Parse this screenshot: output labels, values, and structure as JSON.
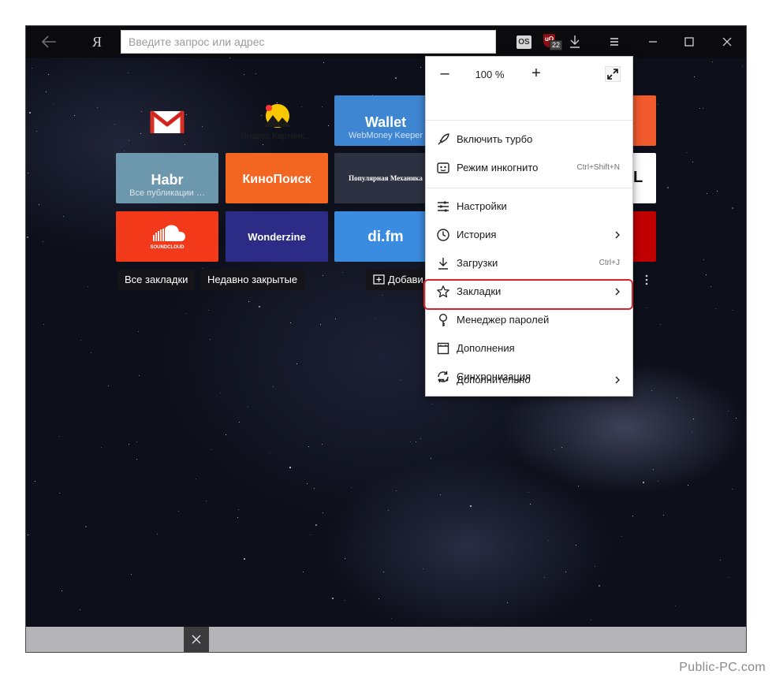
{
  "toolbar": {
    "logo": "Я",
    "address_placeholder": "Введите запрос или адрес",
    "ext_os_label": "OS",
    "ext_ublock_label": "uO",
    "ext_ublock_count": "22"
  },
  "tiles": [
    {
      "title": "",
      "subtitle": "",
      "icon": "gmail-icon",
      "bg": "#ffffff"
    },
    {
      "title": "",
      "subtitle": "Яндекс.Картинк…",
      "icon": "yandex-images-icon",
      "bg": "#ffffff"
    },
    {
      "title": "Wallet",
      "subtitle": "WebMoney Keeper",
      "bg": "#3f86d2"
    },
    {
      "title": "Habr",
      "subtitle": "Все публикации …",
      "bg": "#6d97ad"
    },
    {
      "title": "КиноПоиск",
      "subtitle": "",
      "bg": "#f26622"
    },
    {
      "title": "Популярная Механика",
      "subtitle": "",
      "bg": "#2e3142"
    },
    {
      "title": "",
      "subtitle": "",
      "icon": "soundcloud-icon",
      "brand": "SOUNDCLOUD",
      "bg": "#f23a1a"
    },
    {
      "title": "Wonderzine",
      "subtitle": "",
      "bg": "#2c2c86"
    },
    {
      "title": "di.fm",
      "subtitle": "",
      "bg": "#3a8ce0"
    }
  ],
  "partial_tiles": [
    {
      "text": "",
      "bg": "#f05a2c"
    },
    {
      "text": "L",
      "bg": "#ffffff"
    },
    {
      "text": "",
      "bg": "#c00000"
    }
  ],
  "bookmark_chips": {
    "all": "Все закладки",
    "recent": "Недавно закрытые",
    "add": "Добави"
  },
  "menu": {
    "zoom_minus": "–",
    "zoom_value": "100 %",
    "zoom_plus": "+",
    "items": [
      {
        "label": "Включить турбо",
        "hint": "",
        "icon": "rocket-icon",
        "arrow": false
      },
      {
        "label": "Режим инкогнито",
        "hint": "Ctrl+Shift+N",
        "icon": "incognito-mask-icon",
        "arrow": false
      },
      {
        "label": "Настройки",
        "hint": "",
        "icon": "sliders-icon",
        "arrow": false
      },
      {
        "label": "История",
        "hint": "",
        "icon": "clock-icon",
        "arrow": true
      },
      {
        "label": "Загрузки",
        "hint": "Ctrl+J",
        "icon": "download-icon",
        "arrow": false
      },
      {
        "label": "Закладки",
        "hint": "",
        "icon": "star-icon",
        "arrow": true
      },
      {
        "label": "Менеджер паролей",
        "hint": "",
        "icon": "key-icon",
        "arrow": false
      },
      {
        "label": "Дополнения",
        "hint": "",
        "icon": "extensions-icon",
        "arrow": false
      },
      {
        "label": "Синхронизация",
        "hint": "",
        "icon": "sync-icon",
        "arrow": false
      },
      {
        "label": "Дополнительно",
        "hint": "",
        "icon": "more-dots-icon",
        "arrow": true
      }
    ],
    "highlight_color": "#d8232a"
  },
  "watermark": "Public-PC.com"
}
